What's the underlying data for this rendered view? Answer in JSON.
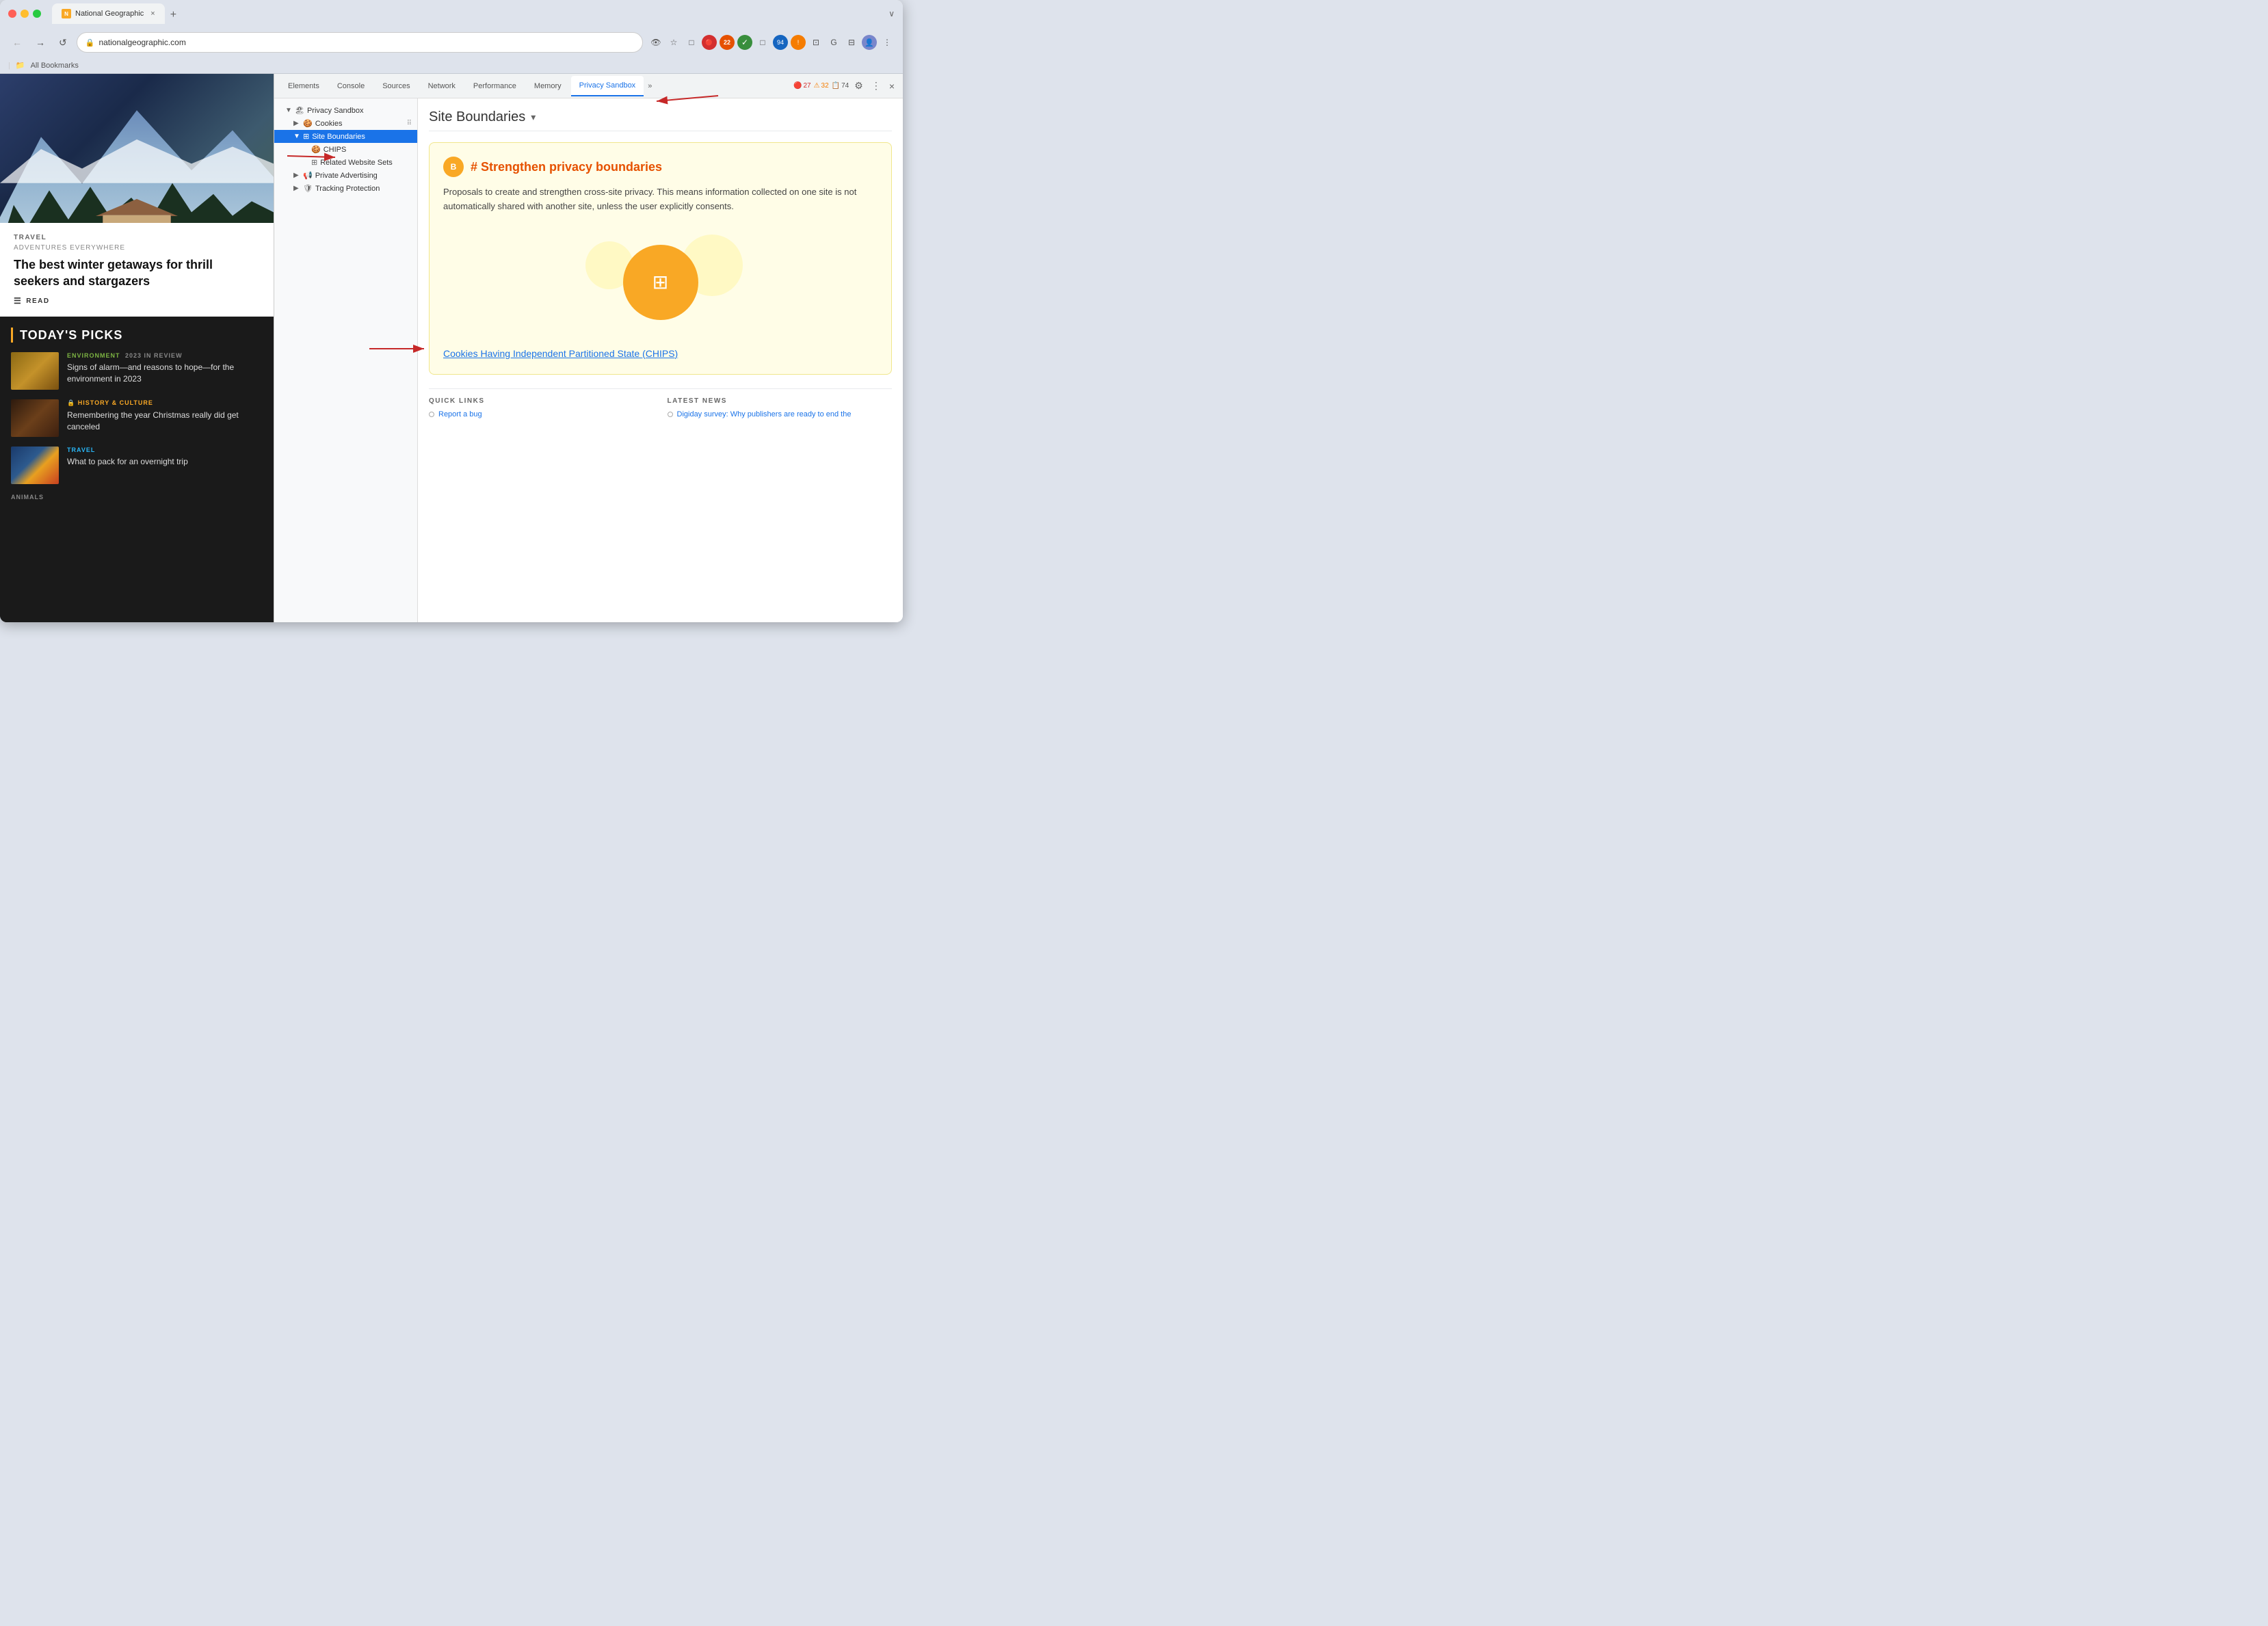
{
  "browser": {
    "tab_title": "National Geographic",
    "url": "nationalgeographic.com",
    "new_tab_symbol": "+",
    "close_symbol": "×",
    "bookmarks_bar_label": "All Bookmarks",
    "bookmarks_icon": "📁"
  },
  "nav": {
    "back": "←",
    "forward": "→",
    "refresh": "↺",
    "star": "☆",
    "more_icon": "⋮"
  },
  "website": {
    "hero_category": "TRAVEL",
    "hero_subtitle": "ADVENTURES EVERYWHERE",
    "hero_title": "The best winter getaways for thrill seekers and stargazers",
    "hero_read": "READ",
    "picks_title": "TODAY'S PICKS",
    "picks": [
      {
        "category": "ENVIRONMENT",
        "year": "2023 IN REVIEW",
        "title": "Signs of alarm—and reasons to hope—for the environment in 2023",
        "thumb_class": "thumb-env"
      },
      {
        "category": "HISTORY & CULTURE",
        "year": "",
        "title": "Remembering the year Christmas really did get canceled",
        "thumb_class": "thumb-hist",
        "lock_icon": "🔒"
      },
      {
        "category": "TRAVEL",
        "year": "",
        "title": "What to pack for an overnight trip",
        "thumb_class": "thumb-travel"
      }
    ],
    "animals_label": "ANIMALS"
  },
  "devtools": {
    "tabs": [
      "Elements",
      "Console",
      "Sources",
      "Network",
      "Performance",
      "Memory",
      "Privacy Sandbox"
    ],
    "active_tab": "Privacy Sandbox",
    "more_symbol": "»",
    "errors": "27",
    "warnings": "32",
    "infos": "74",
    "settings_icon": "⚙",
    "menu_icon": "⋮",
    "close_icon": "×",
    "error_icon": "🔴",
    "warning_icon": "⚠",
    "tree": {
      "root": "Privacy Sandbox",
      "items": [
        {
          "label": "Cookies",
          "level": 1,
          "arrow": "▶",
          "icon": "🍪",
          "has_drag": true
        },
        {
          "label": "Site Boundaries",
          "level": 1,
          "arrow": "▼",
          "icon": "⊞",
          "selected": true
        },
        {
          "label": "CHIPS",
          "level": 2,
          "arrow": "",
          "icon": "🍪"
        },
        {
          "label": "Related Website Sets",
          "level": 2,
          "arrow": "",
          "icon": "⊞"
        },
        {
          "label": "Private Advertising",
          "level": 1,
          "arrow": "▶",
          "icon": "📢"
        },
        {
          "label": "Tracking Protection",
          "level": 1,
          "arrow": "▶",
          "icon": "🛡"
        }
      ]
    },
    "content": {
      "page_title": "Site Boundaries",
      "dropdown_arrow": "▾",
      "card_icon_label": "B",
      "card_title": "# Strengthen privacy boundaries",
      "card_description": "Proposals to create and strengthen cross-site privacy. This means information collected on one site is not automatically shared with another site, unless the user explicitly consents.",
      "chips_link": "Cookies Having Independent Partitioned State (CHIPS)",
      "quick_links_header": "QUICK LINKS",
      "latest_news_header": "LATEST NEWS",
      "quick_links": [
        {
          "label": "Report a bug"
        }
      ],
      "latest_news": [
        {
          "label": "Digiday survey: Why publishers are ready to end the"
        }
      ]
    }
  }
}
